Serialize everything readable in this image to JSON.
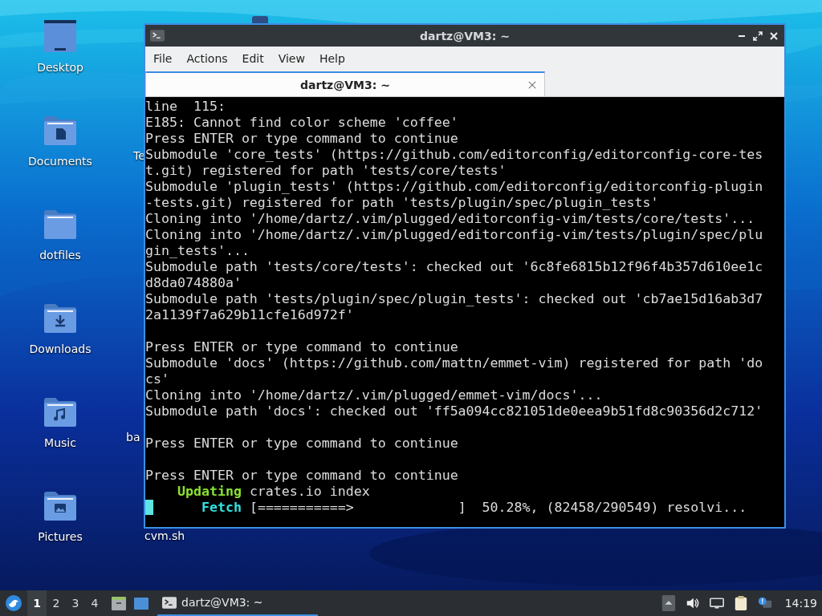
{
  "desktop": {
    "icons": [
      {
        "label": "Desktop",
        "kind": "desktop"
      },
      {
        "label": "Documents",
        "kind": "documents"
      },
      {
        "label": "dotfiles",
        "kind": "folder"
      },
      {
        "label": "Downloads",
        "kind": "downloads"
      },
      {
        "label": "Music",
        "kind": "music"
      },
      {
        "label": "Pictures",
        "kind": "pictures"
      }
    ],
    "second_column": [
      {
        "label": "Te"
      },
      {
        "label": "ba"
      },
      {
        "label": "cvm.sh"
      }
    ]
  },
  "window": {
    "title": "dartz@VM3: ~",
    "menu": [
      "File",
      "Actions",
      "Edit",
      "View",
      "Help"
    ],
    "tabs": [
      {
        "label": "dartz@VM3: ~",
        "selected": true
      }
    ],
    "terminal": {
      "lines": [
        {
          "kind": "text",
          "segments": [
            {
              "text": "line  115:",
              "kind": "plain"
            }
          ]
        },
        {
          "kind": "text",
          "segments": [
            {
              "text": "E185: Cannot find color scheme 'coffee'",
              "kind": "plain"
            }
          ]
        },
        {
          "kind": "text",
          "segments": [
            {
              "text": "Press ENTER or type command to continue",
              "kind": "plain"
            }
          ]
        },
        {
          "kind": "text",
          "segments": [
            {
              "text": "Submodule 'core_tests' (https://github.com/editorconfig/editorconfig-core-tes",
              "kind": "plain"
            }
          ]
        },
        {
          "kind": "text",
          "segments": [
            {
              "text": "t.git) registered for path 'tests/core/tests'",
              "kind": "plain"
            }
          ]
        },
        {
          "kind": "text",
          "segments": [
            {
              "text": "Submodule 'plugin_tests' (https://github.com/editorconfig/editorconfig-plugin",
              "kind": "plain"
            }
          ]
        },
        {
          "kind": "text",
          "segments": [
            {
              "text": "-tests.git) registered for path 'tests/plugin/spec/plugin_tests'",
              "kind": "plain"
            }
          ]
        },
        {
          "kind": "text",
          "segments": [
            {
              "text": "Cloning into '/home/dartz/.vim/plugged/editorconfig-vim/tests/core/tests'...",
              "kind": "plain"
            }
          ]
        },
        {
          "kind": "text",
          "segments": [
            {
              "text": "Cloning into '/home/dartz/.vim/plugged/editorconfig-vim/tests/plugin/spec/plu",
              "kind": "plain"
            }
          ]
        },
        {
          "kind": "text",
          "segments": [
            {
              "text": "gin_tests'...",
              "kind": "plain"
            }
          ]
        },
        {
          "kind": "text",
          "segments": [
            {
              "text": "Submodule path 'tests/core/tests': checked out '6c8fe6815b12f96f4b357d610ee1c",
              "kind": "plain"
            }
          ]
        },
        {
          "kind": "text",
          "segments": [
            {
              "text": "d8da074880a'",
              "kind": "plain"
            }
          ]
        },
        {
          "kind": "text",
          "segments": [
            {
              "text": "Submodule path 'tests/plugin/spec/plugin_tests': checked out 'cb7ae15d16ab3d7",
              "kind": "plain"
            }
          ]
        },
        {
          "kind": "text",
          "segments": [
            {
              "text": "2a1139f7a629b11cfe16d972f'",
              "kind": "plain"
            }
          ]
        },
        {
          "kind": "blank"
        },
        {
          "kind": "text",
          "segments": [
            {
              "text": "Press ENTER or type command to continue",
              "kind": "plain"
            }
          ]
        },
        {
          "kind": "text",
          "segments": [
            {
              "text": "Submodule 'docs' (https://github.com/mattn/emmet-vim) registered for path 'do",
              "kind": "plain"
            }
          ]
        },
        {
          "kind": "text",
          "segments": [
            {
              "text": "cs'",
              "kind": "plain"
            }
          ]
        },
        {
          "kind": "text",
          "segments": [
            {
              "text": "Cloning into '/home/dartz/.vim/plugged/emmet-vim/docs'...",
              "kind": "plain"
            }
          ]
        },
        {
          "kind": "text",
          "segments": [
            {
              "text": "Submodule path 'docs': checked out 'ff5a094cc821051de0eea9b51fd8c90356d2c712'",
              "kind": "plain"
            }
          ]
        },
        {
          "kind": "blank"
        },
        {
          "kind": "text",
          "segments": [
            {
              "text": "Press ENTER or type command to continue",
              "kind": "plain"
            }
          ]
        },
        {
          "kind": "blank"
        },
        {
          "kind": "text",
          "segments": [
            {
              "text": "Press ENTER or type command to continue",
              "kind": "plain"
            }
          ]
        },
        {
          "kind": "text",
          "segments": [
            {
              "text": "    Updating",
              "kind": "green"
            },
            {
              "text": " crates.io index",
              "kind": "plain"
            }
          ]
        },
        {
          "kind": "cursor",
          "segments": [
            {
              "text": "      Fetch",
              "kind": "cyan"
            },
            {
              "text": " [===========>             ]  50.28%, (82458/290549) resolvi...",
              "kind": "plain"
            }
          ]
        }
      ]
    }
  },
  "taskbar": {
    "workspaces": [
      {
        "label": "1",
        "selected": true
      },
      {
        "label": "2",
        "selected": false
      },
      {
        "label": "3",
        "selected": false
      },
      {
        "label": "4",
        "selected": false
      }
    ],
    "tasks": [
      {
        "label": "dartz@VM3: ~",
        "selected": true
      }
    ],
    "clock": "14:19"
  }
}
